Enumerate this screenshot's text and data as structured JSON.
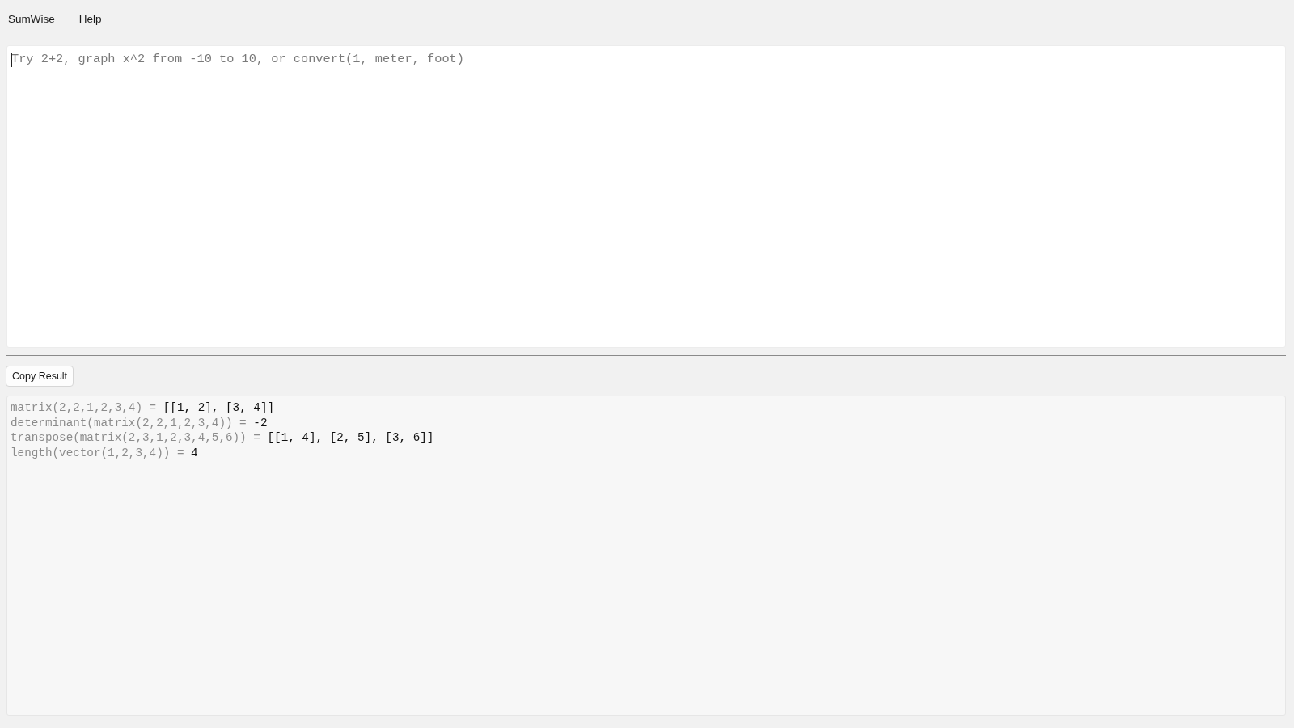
{
  "menu": [
    {
      "label": "SumWise"
    },
    {
      "label": "Help"
    }
  ],
  "input": {
    "placeholder": "Try 2+2, graph x^2 from -10 to 10, or convert(1, meter, foot)",
    "focused": true
  },
  "toolbar": {
    "buttons": [
      "Copy Result"
    ]
  },
  "output": {
    "lines": [
      {
        "expression": "matrix(2,2,1,2,3,4) =",
        "result": "[[1, 2], [3, 4]]"
      },
      {
        "expression": "determinant(matrix(2,2,1,2,3,4)) =",
        "result": "-2"
      },
      {
        "expression": "transpose(matrix(2,3,1,2,3,4,5,6)) =",
        "result": "[[1, 4], [2, 5], [3, 6]]"
      },
      {
        "expression": "length(vector(1,2,3,4)) =",
        "result": "4"
      }
    ]
  }
}
